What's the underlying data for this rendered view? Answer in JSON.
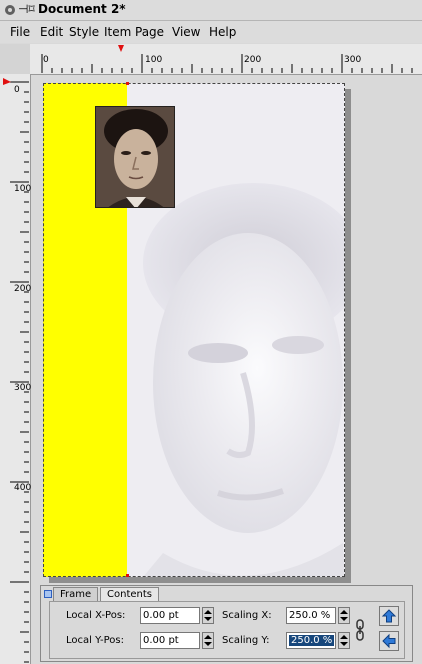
{
  "window": {
    "title": "Document 2*"
  },
  "menu": [
    "File",
    "Edit",
    "Style",
    "Item",
    "Page",
    "View",
    "Help"
  ],
  "rulers": {
    "horizontal_labels": [
      "0",
      "100",
      "200",
      "300"
    ],
    "vertical_labels": [
      "0",
      "100",
      "200",
      "300",
      "400"
    ]
  },
  "panel": {
    "tabs": [
      "Frame",
      "Contents"
    ],
    "active_tab": "Contents",
    "local_x_label": "Local X-Pos:",
    "local_x_value": "0.00 pt",
    "local_y_label": "Local Y-Pos:",
    "local_y_value": "0.00 pt",
    "scaling_x_label": "Scaling X:",
    "scaling_x_value": "250.0 %",
    "scaling_y_label": "Scaling Y:",
    "scaling_y_value": "250.0 %"
  },
  "colors": {
    "frame_fill": "#ffff00",
    "selection": "#17477c",
    "arrow_button": "#2f7ad8"
  }
}
